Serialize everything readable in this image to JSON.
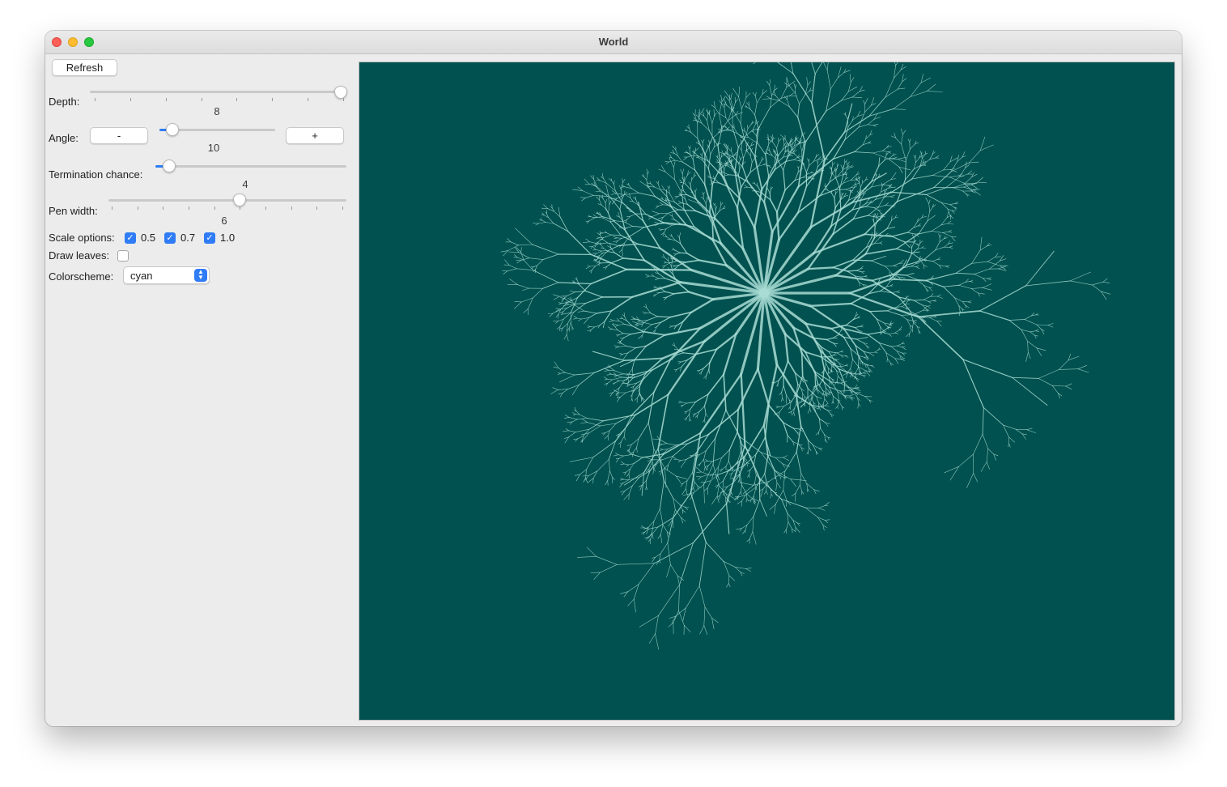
{
  "window": {
    "title": "World"
  },
  "controls": {
    "refresh_label": "Refresh",
    "depth": {
      "label": "Depth:",
      "value": "8",
      "fraction": 1.0
    },
    "angle": {
      "label": "Angle:",
      "minus_label": "-",
      "plus_label": "+",
      "value": "10",
      "fraction": 0.12
    },
    "termination": {
      "label": "Termination chance:",
      "value": "4",
      "fraction": 0.07
    },
    "pen_width": {
      "label": "Pen width:",
      "value": "6",
      "fraction": 0.55
    },
    "scale": {
      "label": "Scale options:",
      "options": [
        {
          "label": "0.5",
          "checked": true
        },
        {
          "label": "0.7",
          "checked": true
        },
        {
          "label": "1.0",
          "checked": true
        }
      ]
    },
    "draw_leaves": {
      "label": "Draw leaves:",
      "checked": false
    },
    "colorscheme": {
      "label": "Colorscheme:",
      "selected": "cyan"
    }
  },
  "canvas": {
    "background": "#00514f",
    "stroke": "#a8dcd4"
  }
}
